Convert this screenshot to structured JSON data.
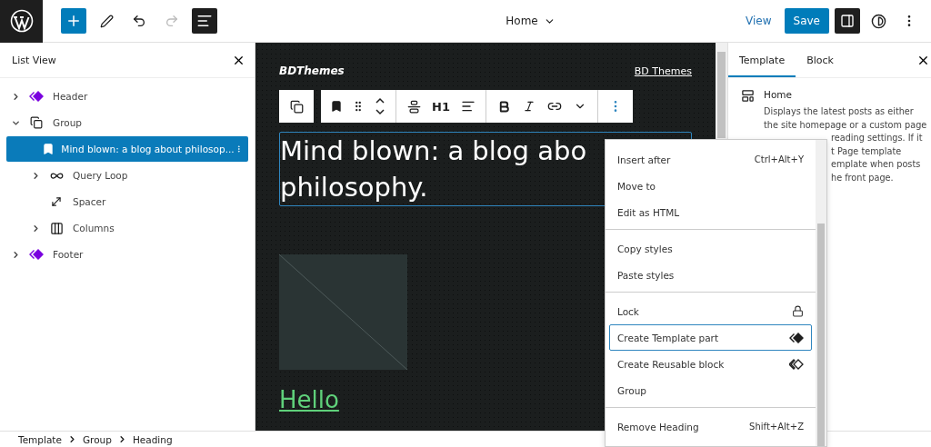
{
  "topbar": {
    "undo_disabled": false,
    "redo_disabled": true,
    "list_view_active": true,
    "title": "Home",
    "view_link": "View",
    "save": "Save",
    "sidebar_active": true
  },
  "list_view": {
    "title": "List View",
    "items": [
      {
        "label": "Header",
        "kind": "template-part",
        "expanded": false,
        "selected": false
      },
      {
        "label": "Group",
        "kind": "group",
        "expanded": true,
        "selected": false,
        "children": [
          {
            "label": "Mind blown: a blog about philosop...",
            "kind": "heading",
            "selected": true
          },
          {
            "label": "Query Loop",
            "kind": "query-loop",
            "expanded": false,
            "selected": false
          },
          {
            "label": "Spacer",
            "kind": "spacer",
            "selected": false
          },
          {
            "label": "Columns",
            "kind": "columns",
            "expanded": false,
            "selected": false
          }
        ]
      },
      {
        "label": "Footer",
        "kind": "template-part",
        "expanded": false,
        "selected": false
      }
    ]
  },
  "canvas": {
    "site_title": "BDThemes",
    "site_link": "BD Themes",
    "toolbar_heading_level": "H1",
    "heading_lines": [
      "Mind blown: a blog abo",
      "philosophy."
    ],
    "image": {
      "kind": "placeholder"
    },
    "link": "Hello"
  },
  "menu": {
    "sections": [
      [
        {
          "label": "Insert after",
          "shortcut": "Ctrl+Alt+Y",
          "focused": false
        },
        {
          "label": "Move to",
          "focused": false
        },
        {
          "label": "Edit as HTML",
          "focused": false
        }
      ],
      [
        {
          "label": "Copy styles",
          "focused": false
        },
        {
          "label": "Paste styles",
          "focused": false
        }
      ],
      [
        {
          "label": "Lock",
          "kind": "lock",
          "focused": false
        },
        {
          "label": "Create Template part",
          "kind": "template-part",
          "focused": true
        },
        {
          "label": "Create Reusable block",
          "kind": "reusable",
          "focused": false
        },
        {
          "label": "Group",
          "kind": "plain",
          "focused": false
        }
      ],
      [
        {
          "label": "Remove Heading",
          "shortcut": "Shift+Alt+Z",
          "focused": false
        }
      ]
    ]
  },
  "sidebar": {
    "tabs": [
      {
        "label": "Template",
        "selected": true
      },
      {
        "label": "Block",
        "selected": false
      }
    ],
    "template_name": "Home",
    "description": [
      {
        "text": "Displays the latest posts as either",
        "covered": false
      },
      {
        "text": "the site homepage or a custom page",
        "covered": false
      },
      {
        "text": "reading settings. If it",
        "covered": true
      },
      {
        "text": "t Page template",
        "covered": true
      },
      {
        "text": "emplate when posts",
        "covered": true
      },
      {
        "text": "he front page.",
        "covered": true
      }
    ]
  },
  "breadcrumb": [
    "Template",
    "Group",
    "Heading"
  ]
}
